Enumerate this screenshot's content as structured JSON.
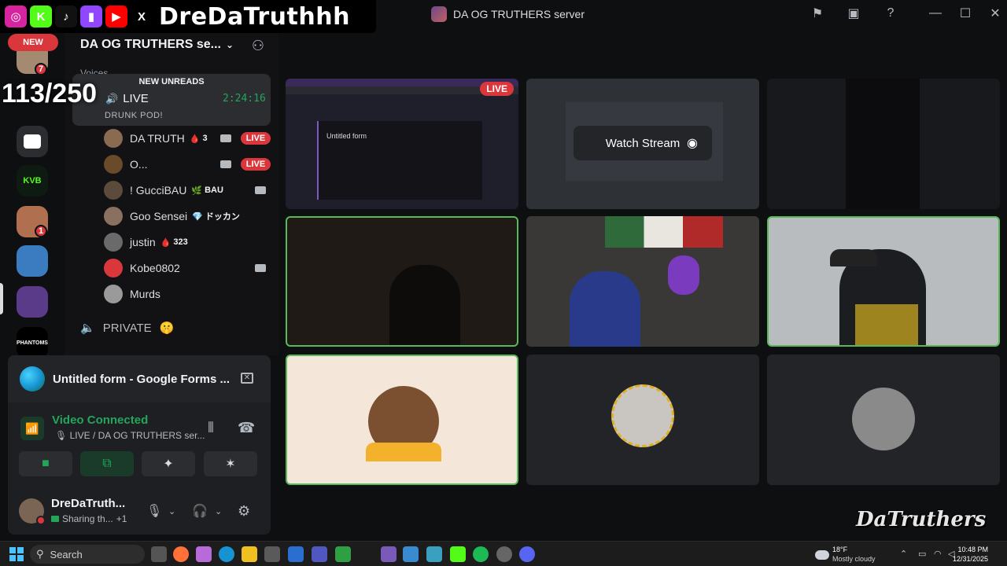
{
  "overlay": {
    "handle": "DreDaTruthhh",
    "counter": "113/250",
    "socials": [
      {
        "icon": "instagram-icon",
        "glyph": "◎",
        "color": "#d6249f"
      },
      {
        "icon": "kick-icon",
        "glyph": "K",
        "color": "#53fc18"
      },
      {
        "icon": "tiktok-icon",
        "glyph": "♪",
        "color": "#111111"
      },
      {
        "icon": "twitch-icon",
        "glyph": "▮",
        "color": "#9146ff"
      },
      {
        "icon": "youtube-icon",
        "glyph": "▶",
        "color": "#ff0000"
      },
      {
        "icon": "x-icon",
        "glyph": "X",
        "color": "#000000"
      }
    ]
  },
  "titlebar": {
    "server_title": "DA OG TRUTHERS server"
  },
  "rail": {
    "new_label": "NEW",
    "badges": [
      "7",
      "1"
    ]
  },
  "sidebar": {
    "server_name": "DA OG TRUTHERS se...",
    "voice_category": "Voices",
    "new_unreads": "NEW UNREADS",
    "live_channel": "LIVE",
    "timer": "2:24:16",
    "channel_status": "DRUNK POD!",
    "members": [
      {
        "name": "DA TRUTH",
        "tag": "3",
        "tag_icon": "🩸",
        "live": "LIVE",
        "color": "#8a6a50"
      },
      {
        "name": "O...",
        "tag": "",
        "tag_icon": "",
        "live": "LIVE",
        "color": "#6b4a2a"
      },
      {
        "name": "! GucciBAU",
        "tag": "BAU",
        "tag_icon": "🌿",
        "live": "",
        "color": "#5c4a3a"
      },
      {
        "name": "Goo Sensei",
        "tag": "ドッカン",
        "tag_icon": "💎",
        "live": "",
        "color": "#8a7060"
      },
      {
        "name": "justin",
        "tag": "323",
        "tag_icon": "🩸",
        "live": "",
        "color": "#6a6a6a"
      },
      {
        "name": "Kobe0802",
        "tag": "",
        "tag_icon": "",
        "live": "",
        "color": "#da373c"
      },
      {
        "name": "Murds",
        "tag": "",
        "tag_icon": "",
        "live": "",
        "color": "#9a9a9a"
      }
    ],
    "private_channel": "PRIVATE"
  },
  "panel": {
    "stream_title": "Untitled form - Google Forms ...",
    "video_status": "Video Connected",
    "video_sub": "LIVE / DA OG TRUTHERS ser...",
    "user_name": "DreDaTruth...",
    "user_status": "Sharing th...",
    "user_status_extra": "+1"
  },
  "grid": {
    "live_badge": "LIVE",
    "watch_stream": "Watch Stream",
    "form_title": "Untitled form"
  },
  "watermark": "DaTruthers",
  "taskbar": {
    "search": "Search",
    "weather_temp": "18°F",
    "weather_desc": "Mostly cloudy",
    "time": "10:48 PM",
    "date": "12/31/2025"
  }
}
